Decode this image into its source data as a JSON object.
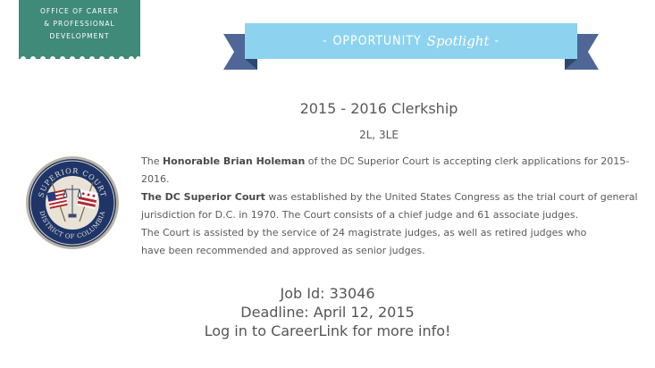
{
  "office": {
    "line1": "OFFICE OF CAREER",
    "line2": "& PROFESSIONAL",
    "line3": "DEVELOPMENT",
    "color": "#3f8a78"
  },
  "banner": {
    "dash_left": "-",
    "word": "OPPORTUNITY",
    "spotlight": "Spotlight",
    "dash_right": "-",
    "ribbon_color": "#8dd3ef",
    "tail_color": "#4e6796"
  },
  "job": {
    "title": "2015 - 2016 Clerkship",
    "eligibility": "2L, 3LE"
  },
  "seal": {
    "top_text": "SUPERIOR COURT",
    "bottom_text": "DISTRICT OF COLUMBIA"
  },
  "paragraph1": {
    "pre": "The ",
    "judge": "Honorable Brian Holeman",
    "post": " of the DC Superior Court is accepting clerk applications for 2015-2016."
  },
  "paragraph2": {
    "court": "The DC Superior Court",
    "line1_rest": " was established by the United States Congress as the trial court of general",
    "line2": "jurisdiction for D.C. in 1970. The Court consists of a chief judge and 61 associate judges.",
    "line3": "The Court is assisted by the service of 24 magistrate judges, as well as retired judges who",
    "line4": "have been recommended and approved as senior judges."
  },
  "footer": {
    "job_id": "Job Id: 33046",
    "deadline": "Deadline: April 12, 2015",
    "cta": "Log in to CareerLink for more info!"
  }
}
